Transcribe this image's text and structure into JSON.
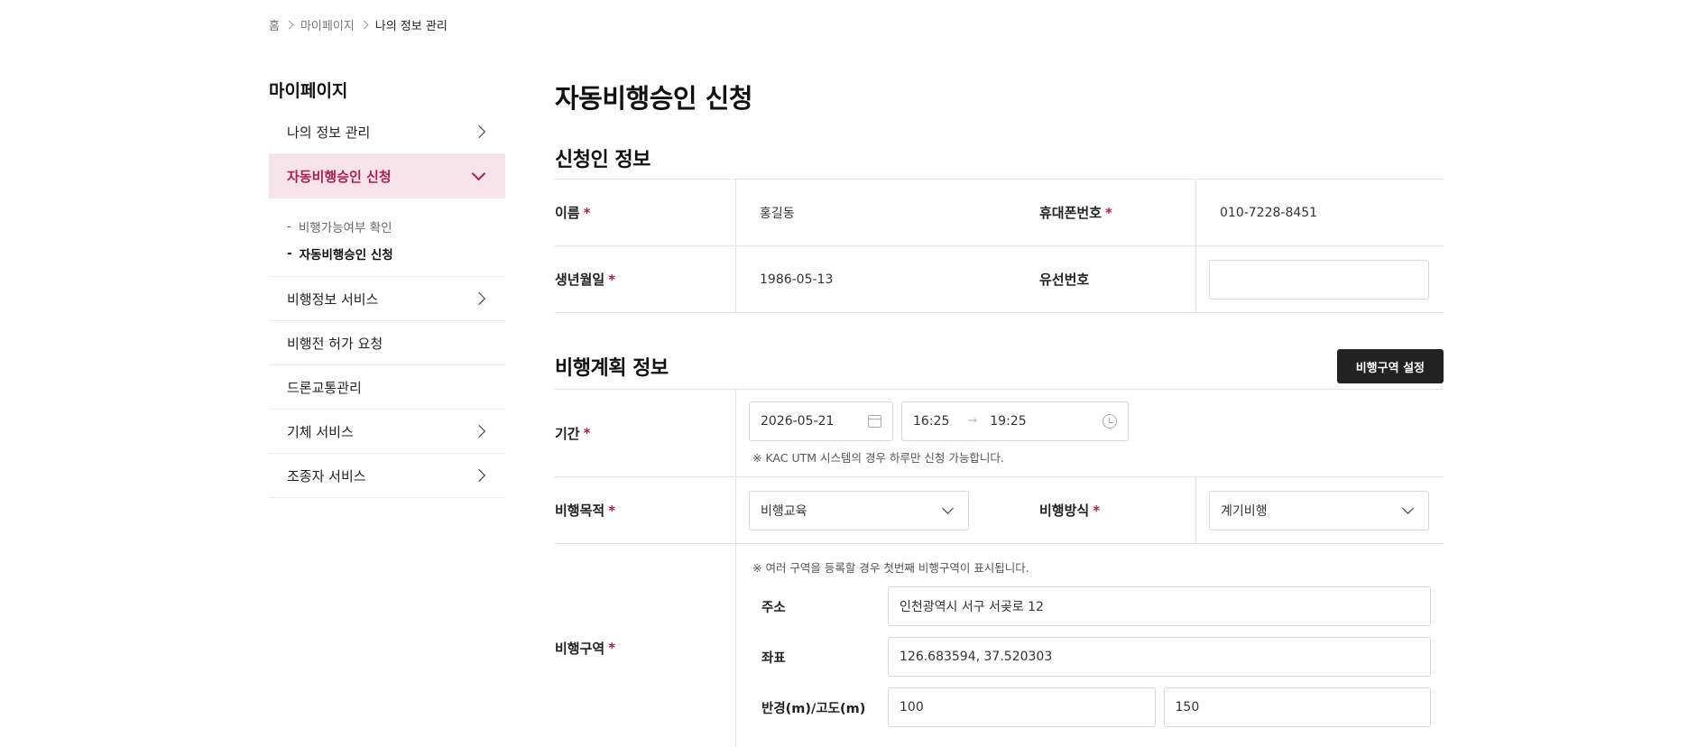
{
  "breadcrumb": {
    "home": "홈",
    "mypage": "마이페이지",
    "current": "나의 정보 관리"
  },
  "sidebar": {
    "title": "마이페이지",
    "items": [
      {
        "label": "나의 정보 관리"
      },
      {
        "label": "자동비행승인 신청"
      },
      {
        "label": "비행정보 서비스"
      },
      {
        "label": "비행전 허가 요청"
      },
      {
        "label": "드론교통관리"
      },
      {
        "label": "기체 서비스"
      },
      {
        "label": "조종자 서비스"
      }
    ],
    "sub_items": [
      {
        "label": "비행가능여부 확인"
      },
      {
        "label": "자동비행승인 신청"
      }
    ],
    "sub_dash": "-"
  },
  "main": {
    "title": "자동비행승인 신청",
    "applicant": {
      "section_title": "신청인 정보",
      "name_label": "이름",
      "name_value": "홍길동",
      "phone_label": "휴대폰번호",
      "phone_value": "010-7228-8451",
      "birth_label": "생년월일",
      "birth_value": "1986-05-13",
      "landline_label": "유선번호",
      "landline_value": ""
    },
    "plan": {
      "section_title": "비행계획 정보",
      "zone_button": "비행구역 설정",
      "period_label": "기간",
      "date_value": "2026-05-21",
      "time_start": "16:25",
      "time_arrow": "→",
      "time_end": "19:25",
      "period_note": "※ KAC UTM 시스템의 경우 하루만 신청 가능합니다.",
      "purpose_label": "비행목적",
      "purpose_value": "비행교육",
      "method_label": "비행방식",
      "method_value": "계기비행",
      "zone_label": "비행구역",
      "zone_note": "※ 여러 구역을 등록할 경우 첫번째 비행구역이 표시됩니다.",
      "address_label": "주소",
      "address_value": "인천광역시 서구 서곶로 12",
      "coord_label": "좌표",
      "coord_value": "126.683594, 37.520303",
      "radius_label": "반경(m)/고도(m)",
      "radius_value": "100",
      "altitude_value": "150"
    },
    "required_mark": "*"
  },
  "colors": {
    "accent": "#b01d4e",
    "active_bg": "#f6e4ea",
    "button_bg": "#222222"
  }
}
